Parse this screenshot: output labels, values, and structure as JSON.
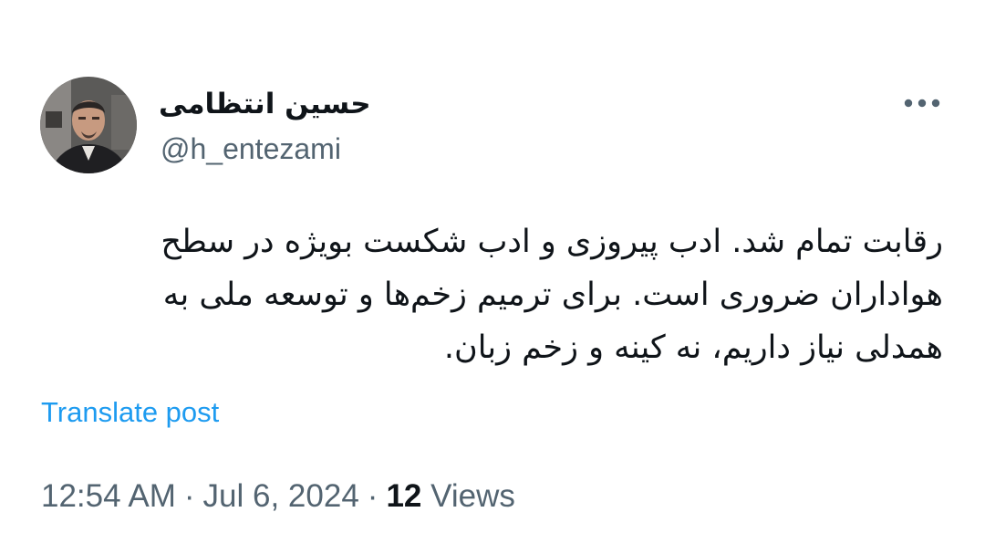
{
  "author": {
    "display_name": "حسین انتظامی",
    "handle": "@h_entezami"
  },
  "tweet": {
    "text_lines": [
      "رقابت تمام شد. ادب پیروزی و ادب شکست بویژه در سطح",
      "هواداران ضروری است. برای ترمیم زخم‌ها و توسعه ملی به",
      "همدلی نیاز داریم، نه کینه و زخم زبان."
    ],
    "translate_label": "Translate post"
  },
  "meta": {
    "time": "12:54 AM",
    "separator": "·",
    "date": "Jul 6, 2024",
    "views_count": "12",
    "views_label": "Views"
  },
  "icons": {
    "more": "more-horizontal-icon",
    "avatar": "profile-photo"
  },
  "colors": {
    "text_primary": "#0f1419",
    "text_secondary": "#536471",
    "link": "#1d9bf0",
    "background": "#ffffff"
  }
}
